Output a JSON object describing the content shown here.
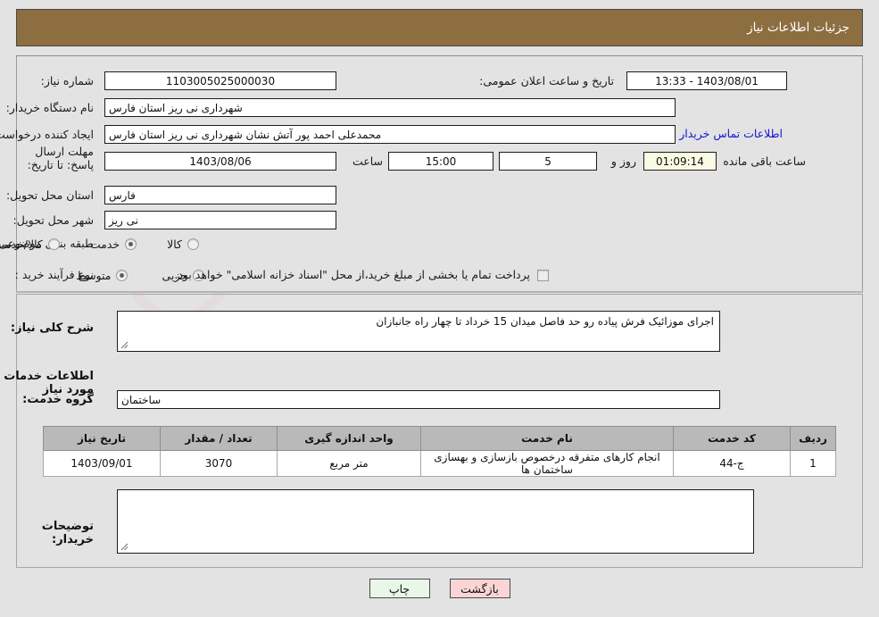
{
  "header": {
    "title": "جزئیات اطلاعات نیاز"
  },
  "colors": {
    "header_bg": "#8d6e41",
    "page_bg": "#e3e3e3",
    "link": "#1414d2",
    "table_header_bg": "#b9b9b9",
    "timer_bg": "#fbfbe4",
    "print_btn_bg": "#e9f7e9",
    "back_btn_bg": "#fbd5d5"
  },
  "top_form": {
    "need_number_label": "شماره نیاز:",
    "need_number_value": "1103005025000030",
    "announce_datetime_label": "تاریخ و ساعت اعلان عمومی:",
    "announce_datetime_value": "1403/08/01 - 13:33",
    "buyer_org_label": "نام دستگاه خریدار:",
    "buyer_org_value": "شهرداری نی ریز استان فارس",
    "creator_label": "ایجاد کننده درخواست:",
    "creator_value": "محمدعلی احمد پور آتش نشان شهرداری نی ریز استان فارس",
    "contact_link": "اطلاعات تماس خریدار",
    "deadline_label": "مهلت ارسال پاسخ: تا تاریخ:",
    "deadline_date": "1403/08/06",
    "time_label": "ساعت",
    "time_value": "15:00",
    "days_value": "5",
    "days_suffix": "روز و",
    "countdown_value": "01:09:14",
    "countdown_suffix": "ساعت باقی مانده",
    "province_label": "استان محل تحویل:",
    "province_value": "فارس",
    "city_label": "شهر محل تحویل:",
    "city_value": "نی ریز",
    "category_label": "طبقه بندی موضوعی:",
    "category_options": [
      {
        "label": "کالا",
        "selected": false
      },
      {
        "label": "خدمت",
        "selected": true
      },
      {
        "label": "کالا/خدمت",
        "selected": false
      }
    ],
    "process_label": "نوع فرآیند خرید :",
    "process_options": [
      {
        "label": "جزیی",
        "selected": false
      },
      {
        "label": "متوسط",
        "selected": true
      }
    ],
    "treasury_checkbox_checked": false,
    "treasury_note": "پرداخت تمام یا بخشی از مبلغ خرید،از محل \"اسناد خزانه اسلامی\" خواهد بود."
  },
  "need_summary": {
    "label": "شرح کلی نیاز:",
    "value": "اجرای موزائیک فرش پیاده رو حد فاصل میدان 15 خرداد تا چهار راه جانبازان"
  },
  "services_section": {
    "heading": "اطلاعات خدمات مورد نیاز",
    "group_label": "گروه خدمت:",
    "group_value": "ساختمان",
    "table": {
      "columns": [
        "ردیف",
        "کد خدمت",
        "نام خدمت",
        "واحد اندازه گیری",
        "تعداد / مقدار",
        "تاریخ نیاز"
      ],
      "rows": [
        {
          "row_no": "1",
          "service_code": "ج-44",
          "service_name": "انجام کارهای متفرقه درخصوص بازسازی و بهسازی ساختمان ها",
          "unit": "متر مربع",
          "quantity": "3070",
          "need_date": "1403/09/01"
        }
      ]
    }
  },
  "buyer_notes": {
    "label": "توضیحات خریدار:",
    "value": ""
  },
  "buttons": {
    "print": "چاپ",
    "back": "بازگشت"
  },
  "watermark": {
    "text": "AriaTender.net"
  },
  "icons": {
    "resize_grip": "◣"
  }
}
